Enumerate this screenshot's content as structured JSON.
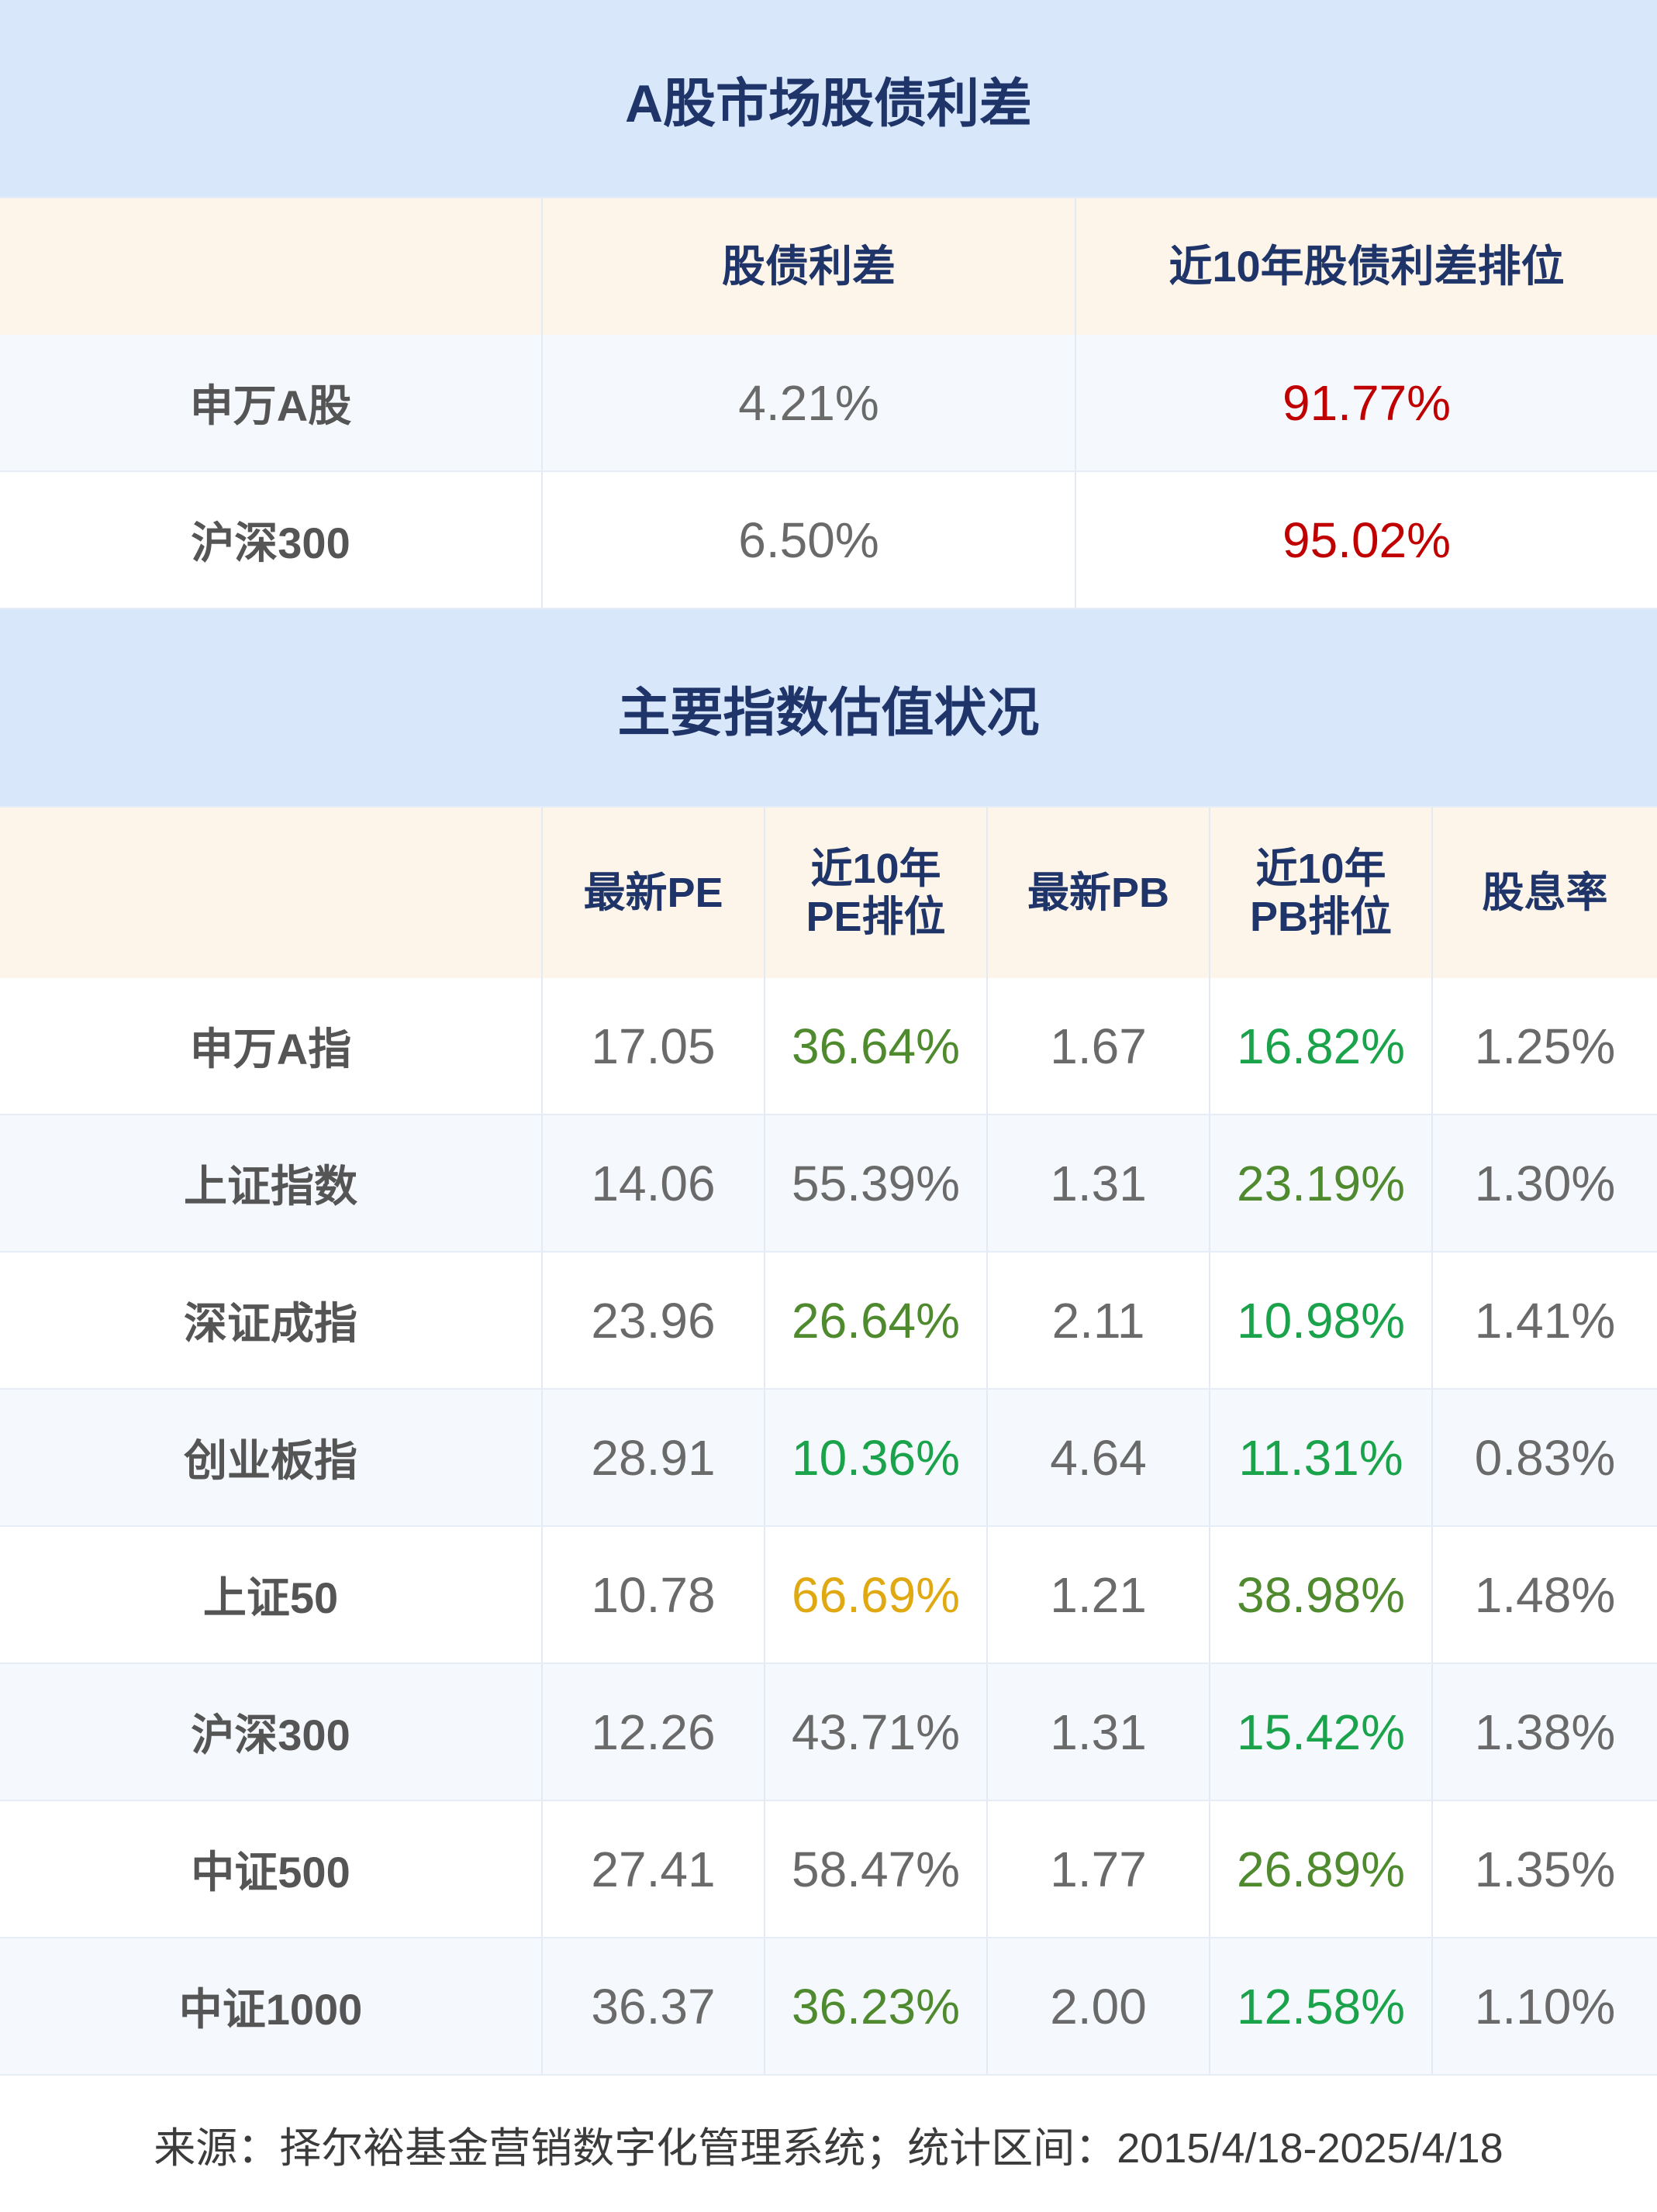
{
  "section1": {
    "title": "A股市场股债利差",
    "headers": [
      "",
      "股债利差",
      "近10年股债利差排位"
    ],
    "rows": [
      {
        "name": "申万A股",
        "spread": "4.21%",
        "rank": "91.77%",
        "rank_color": "red"
      },
      {
        "name": "沪深300",
        "spread": "6.50%",
        "rank": "95.02%",
        "rank_color": "red"
      }
    ]
  },
  "section2": {
    "title": "主要指数估值状况",
    "headers": [
      "",
      "最新PE",
      "近10年\nPE排位",
      "最新PB",
      "近10年\nPB排位",
      "股息率"
    ],
    "rows": [
      {
        "name": "申万A指",
        "pe": "17.05",
        "pe_rank": "36.64%",
        "pe_rank_color": "dkgreen",
        "pb": "1.67",
        "pb_rank": "16.82%",
        "pb_rank_color": "green",
        "dividend": "1.25%"
      },
      {
        "name": "上证指数",
        "pe": "14.06",
        "pe_rank": "55.39%",
        "pe_rank_color": "neutral",
        "pb": "1.31",
        "pb_rank": "23.19%",
        "pb_rank_color": "dkgreen",
        "dividend": "1.30%"
      },
      {
        "name": "深证成指",
        "pe": "23.96",
        "pe_rank": "26.64%",
        "pe_rank_color": "dkgreen",
        "pb": "2.11",
        "pb_rank": "10.98%",
        "pb_rank_color": "green",
        "dividend": "1.41%"
      },
      {
        "name": "创业板指",
        "pe": "28.91",
        "pe_rank": "10.36%",
        "pe_rank_color": "green",
        "pb": "4.64",
        "pb_rank": "11.31%",
        "pb_rank_color": "green",
        "dividend": "0.83%"
      },
      {
        "name": "上证50",
        "pe": "10.78",
        "pe_rank": "66.69%",
        "pe_rank_color": "gold",
        "pb": "1.21",
        "pb_rank": "38.98%",
        "pb_rank_color": "dkgreen",
        "dividend": "1.48%"
      },
      {
        "name": "沪深300",
        "pe": "12.26",
        "pe_rank": "43.71%",
        "pe_rank_color": "neutral",
        "pb": "1.31",
        "pb_rank": "15.42%",
        "pb_rank_color": "green",
        "dividend": "1.38%"
      },
      {
        "name": "中证500",
        "pe": "27.41",
        "pe_rank": "58.47%",
        "pe_rank_color": "neutral",
        "pb": "1.77",
        "pb_rank": "26.89%",
        "pb_rank_color": "dkgreen",
        "dividend": "1.35%"
      },
      {
        "name": "中证1000",
        "pe": "36.37",
        "pe_rank": "36.23%",
        "pe_rank_color": "dkgreen",
        "pb": "2.00",
        "pb_rank": "12.58%",
        "pb_rank_color": "green",
        "dividend": "1.10%"
      }
    ]
  },
  "footer": {
    "text": "来源：择尔裕基金营销数字化管理系统；统计区间：2015/4/18-2025/4/18"
  },
  "colors": {
    "title_bg": "#d9e7fb",
    "title_text": "#1f3569",
    "header_bg": "#fdf5e9",
    "alt_row_bg": "#f5f9fe",
    "red": "#c00000",
    "dark_green": "#4f8a2e",
    "green": "#1aa34a",
    "gold": "#e0a912",
    "neutral": "#6a6a6a"
  }
}
